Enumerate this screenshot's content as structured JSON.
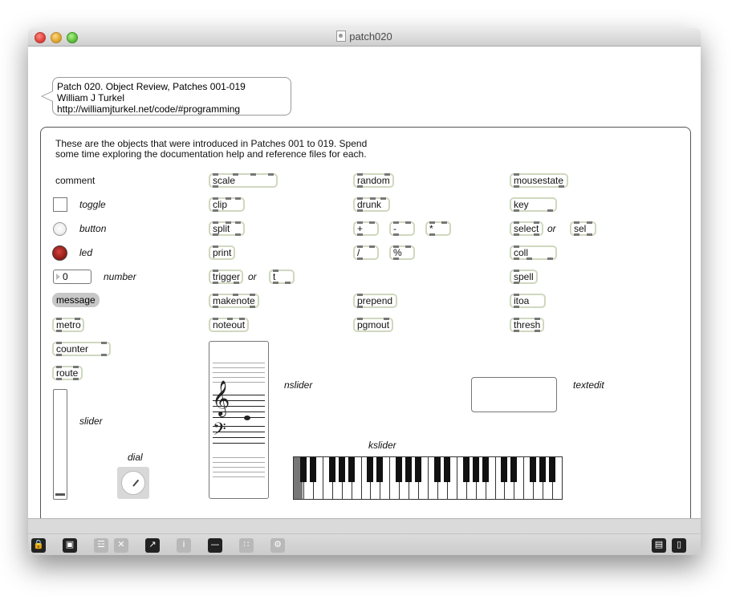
{
  "window": {
    "title": "patch020"
  },
  "bubble": {
    "line1": "Patch 020. Object Review, Patches 001-019",
    "line2": "William J Turkel",
    "line3": "http://williamjturkel.net/code/#programming"
  },
  "intro": {
    "line1": "These are the objects that were introduced in Patches 001 to 019. Spend",
    "line2": "some time exploring the documentation help and reference files for each."
  },
  "col1": {
    "comment": "comment",
    "toggle_label": "toggle",
    "button_label": "button",
    "led_label": "led",
    "number_value": "0",
    "number_label": "number",
    "message": "message",
    "metro": "metro",
    "counter": "counter",
    "route": "route",
    "slider_label": "slider",
    "dial_label": "dial"
  },
  "col2": {
    "scale": "scale",
    "clip": "clip",
    "split": "split",
    "print": "print",
    "trigger": "trigger",
    "or": "or",
    "t": "t",
    "makenote": "makenote",
    "noteout": "noteout",
    "nslider_label": "nslider"
  },
  "col3": {
    "random": "random",
    "drunk": "drunk",
    "plus": "+",
    "minus": "-",
    "times": "*",
    "divide": "/",
    "modulo": "%",
    "prepend": "prepend",
    "pgmout": "pgmout",
    "kslider_label": "kslider"
  },
  "col4": {
    "mousestate": "mousestate",
    "key": "key",
    "select": "select",
    "or": "or",
    "sel": "sel",
    "coll": "coll",
    "spell": "spell",
    "itoa": "itoa",
    "thresh": "thresh",
    "textedit_label": "textedit"
  },
  "toolbar": {
    "icons": [
      "lock-icon",
      "presentation-icon",
      "new-object-icon",
      "delete-icon",
      "debug-icon",
      "info-icon",
      "connection-icon",
      "grid-icon",
      "settings-icon",
      "patcher-view-icon",
      "presentation-view-icon"
    ]
  }
}
